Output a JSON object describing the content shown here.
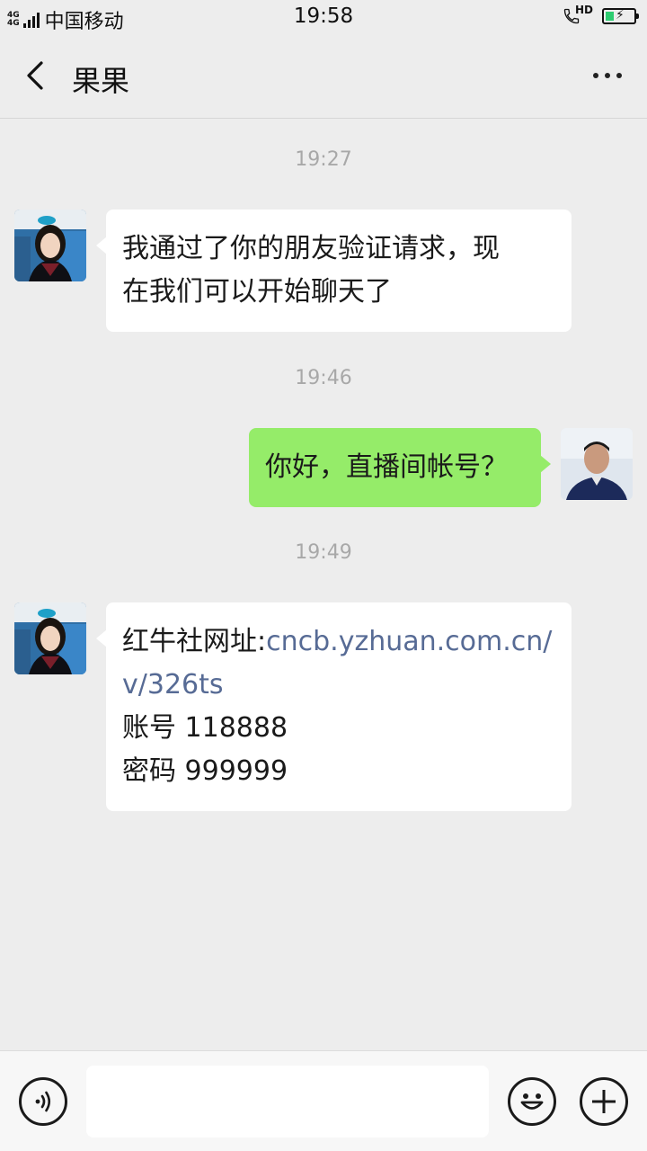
{
  "status_bar": {
    "net_top": "4G",
    "net_bottom": "4G",
    "carrier": "中国移动",
    "time": "19:58",
    "hd_label": "HD",
    "battery_level": 0.25,
    "battery_color": "#2ecc71"
  },
  "header": {
    "title": "果果",
    "back_icon": "chevron-left-icon",
    "more_icon": "more-dots-icon"
  },
  "messages": [
    {
      "type": "time",
      "text": "19:27"
    },
    {
      "type": "incoming",
      "lines": [
        "我通过了你的朋友验证请求，现",
        "在我们可以开始聊天了"
      ]
    },
    {
      "type": "time",
      "text": "19:46"
    },
    {
      "type": "outgoing",
      "text": "你好，直播间帐号？"
    },
    {
      "type": "time",
      "text": "19:49"
    },
    {
      "type": "incoming",
      "prefix": "红牛社网址:",
      "link_part1": "cncb.yzhuan.com.cn/",
      "link_part2": "v/326ts",
      "account_line": "账号  118888",
      "password_line": "密码  999999"
    }
  ],
  "colors": {
    "outgoing_bubble": "#95ec69",
    "incoming_bubble": "#ffffff",
    "link": "#576b95",
    "background": "#ededed"
  },
  "input_bar": {
    "voice_icon": "voice-icon",
    "emoji_icon": "emoji-icon",
    "plus_icon": "plus-icon",
    "input_value": ""
  }
}
